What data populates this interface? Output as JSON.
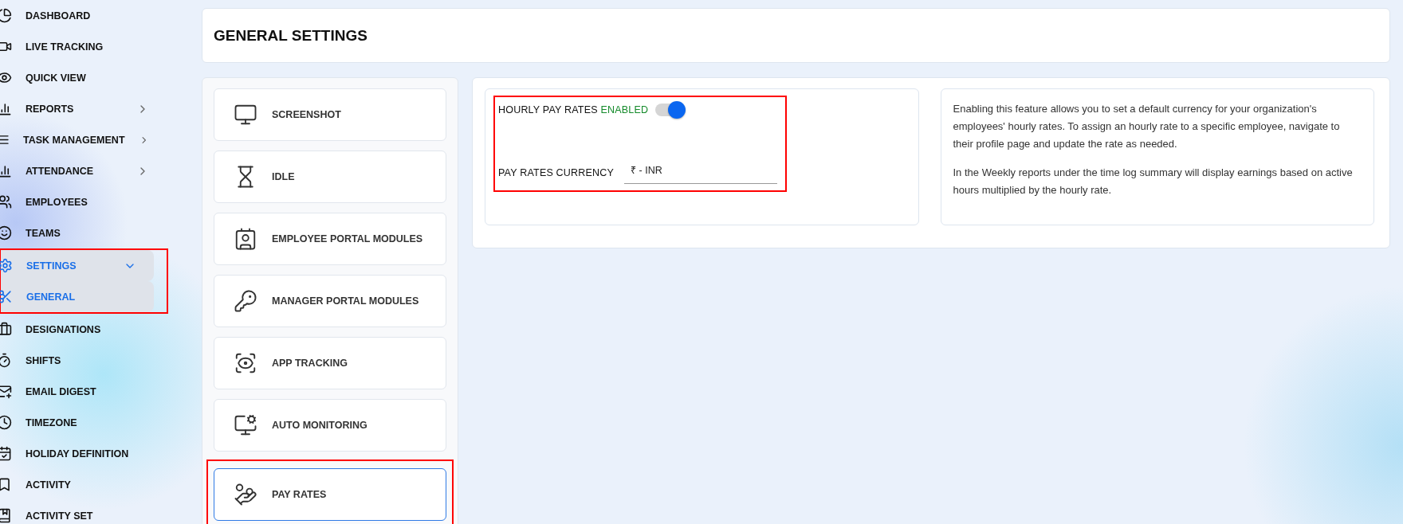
{
  "sidebar": {
    "items": [
      {
        "label": "DASHBOARD",
        "expandable": false
      },
      {
        "label": "LIVE TRACKING",
        "expandable": false
      },
      {
        "label": "QUICK VIEW",
        "expandable": false
      },
      {
        "label": "REPORTS",
        "expandable": true,
        "expanded": false
      },
      {
        "label": "TASK MANAGEMENT",
        "expandable": true,
        "expanded": false
      },
      {
        "label": "ATTENDANCE",
        "expandable": true,
        "expanded": false
      },
      {
        "label": "EMPLOYEES",
        "expandable": false
      },
      {
        "label": "TEAMS",
        "expandable": false
      },
      {
        "label": "SETTINGS",
        "expandable": true,
        "expanded": true,
        "highlighted": true,
        "children": [
          {
            "label": "GENERAL",
            "selected": true
          }
        ]
      },
      {
        "label": "DESIGNATIONS",
        "expandable": false
      },
      {
        "label": "SHIFTS",
        "expandable": false
      },
      {
        "label": "EMAIL DIGEST",
        "expandable": false
      },
      {
        "label": "TIMEZONE",
        "expandable": false
      },
      {
        "label": "HOLIDAY DEFINITION",
        "expandable": false
      },
      {
        "label": "ACTIVITY",
        "expandable": false
      },
      {
        "label": "ACTIVITY SET",
        "expandable": false
      }
    ]
  },
  "page_title": "GENERAL SETTINGS",
  "modules": [
    {
      "label": "SCREENSHOT",
      "selected": false,
      "highlighted": false
    },
    {
      "label": "IDLE",
      "selected": false,
      "highlighted": false
    },
    {
      "label": "EMPLOYEE PORTAL MODULES",
      "selected": false,
      "highlighted": false
    },
    {
      "label": "MANAGER PORTAL MODULES",
      "selected": false,
      "highlighted": false
    },
    {
      "label": "APP TRACKING",
      "selected": false,
      "highlighted": false
    },
    {
      "label": "AUTO MONITORING",
      "selected": false,
      "highlighted": false
    },
    {
      "label": "PAY RATES",
      "selected": true,
      "highlighted": true
    }
  ],
  "pay_rates": {
    "highlighted": true,
    "toggle": {
      "label": "HOURLY PAY RATES",
      "status": "ENABLED",
      "on": true
    },
    "currency": {
      "label": "PAY RATES CURRENCY",
      "value": "₹ - INR"
    }
  },
  "description": [
    "Enabling this feature allows you to set a default currency for your organization's employees' hourly rates. To assign an hourly rate to a specific employee, navigate to their profile page and update the rate as needed.",
    "In the Weekly reports under the time log summary will display earnings based on active hours multiplied by the hourly rate."
  ]
}
